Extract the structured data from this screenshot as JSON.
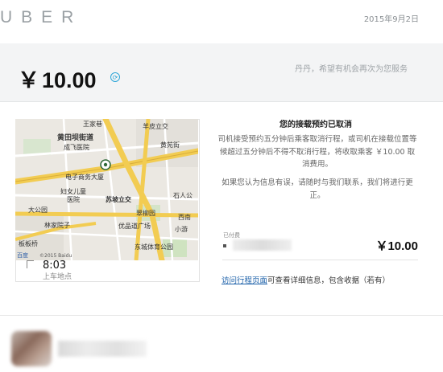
{
  "header": {
    "logo": "UBER",
    "date": "2015年9月2日"
  },
  "fare": {
    "currency": "￥",
    "total": "10.00",
    "icon": "info-icon",
    "greeting": "丹丹，希望有机会再次为您服务"
  },
  "map": {
    "labels": {
      "huangtianba": "黄田坝街道",
      "wangjiaxiang": "王家巷",
      "chenggu": "成飞医院",
      "yangpi": "羊皮立交",
      "dianzi": "电子商务大厦",
      "funv": "妇女儿童",
      "yiyuan": "医院",
      "suping": "苏坡立交",
      "damiaoyuan": "翠柳园",
      "dazhumiao": "大公园",
      "linjiayuan": "林家院子",
      "banqiao": "板板桥",
      "youpin": "优品道广场",
      "xiaoyou": "小游",
      "dongcheng": "东城体育公园",
      "shiren": "石人公",
      "xinan": "西南",
      "huangji": "黄苑街",
      "baidu": "百度",
      "copyright": "©2015 Baidu"
    },
    "pickup_time": "8:03",
    "pickup_label": "上车地点"
  },
  "cancellation": {
    "title": "您的接载预约已取消",
    "body": "司机接受预约五分钟后乘客取消行程，或司机在接载位置等候超过五分钟后不得不取消行程，将收取乘客 ￥10.00 取消费用。",
    "contact": "如果您认为信息有误，请随时与我们联系，我们将进行更正。"
  },
  "payment": {
    "label": "已付费",
    "amount": "￥10.00"
  },
  "trip": {
    "link": "访问行程页面",
    "text": "可查看详细信息，包含收据（若有）"
  },
  "colors": {
    "accent": "#2ea6d8",
    "link": "#1a5fa8",
    "road_yellow": "#f2cc52"
  }
}
